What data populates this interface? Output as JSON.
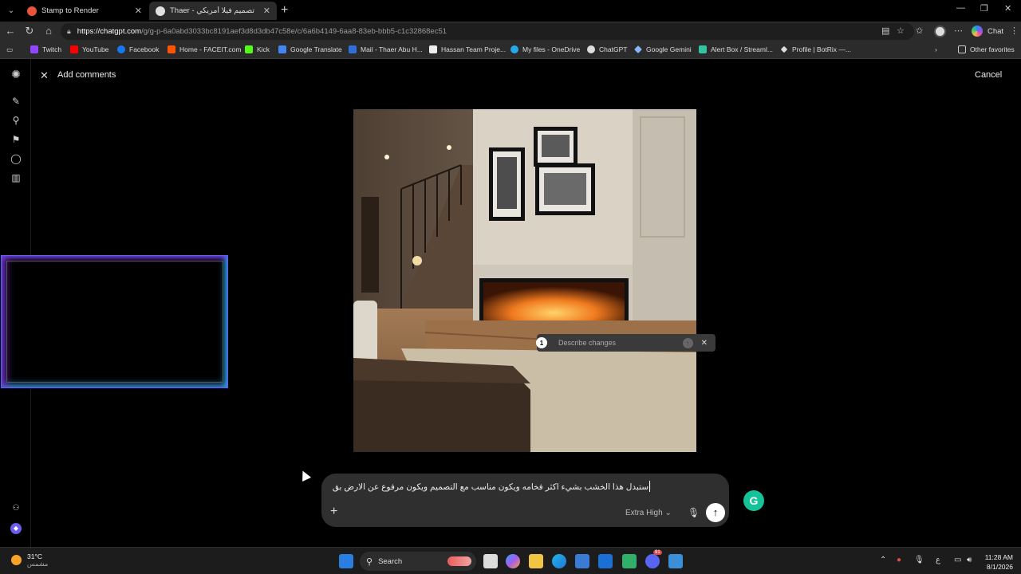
{
  "browser": {
    "tabs": [
      {
        "title": "Stamp to Render",
        "favicon_color": "#e8533a"
      },
      {
        "title": "Thaer - تصميم فيلا أمريكي",
        "favicon_color": "#e0e0e0"
      }
    ],
    "url": {
      "host": "https://chatgpt.com",
      "path": "/g/g-p-6a0abd3033bc8191aef3d8d3db47c58e/c/6a6b4149-6aa8-83eb-bbb5-c1c32868ec51"
    },
    "copilot_label": "Chat",
    "bookmarks": [
      {
        "label": "Twitch",
        "color": "#9146ff"
      },
      {
        "label": "YouTube",
        "color": "#ff0000"
      },
      {
        "label": "Facebook",
        "color": "#1877f2"
      },
      {
        "label": "Home - FACEIT.com",
        "color": "#ff5500"
      },
      {
        "label": "Kick",
        "color": "#53fc18"
      },
      {
        "label": "Google Translate",
        "color": "#4285f4"
      },
      {
        "label": "Mail - Thaer Abu H...",
        "color": "#2f6fdb"
      },
      {
        "label": "Hassan Team Proje...",
        "color": "#eeeeee"
      },
      {
        "label": "My files - OneDrive",
        "color": "#28a8ea"
      },
      {
        "label": "ChatGPT",
        "color": "#dddddd"
      },
      {
        "label": "Google Gemini",
        "color": "#8ab4f8"
      },
      {
        "label": "Alert Box / Streaml...",
        "color": "#31c3a2"
      },
      {
        "label": "Profile | BotRix —...",
        "color": "#dddddd"
      }
    ],
    "other_favorites": "Other favorites"
  },
  "editor": {
    "title": "Add comments",
    "cancel": "Cancel",
    "comment": {
      "number": "1",
      "placeholder": "Describe changes"
    }
  },
  "composer": {
    "text": "استبدل هذا الخشب بشيء اكثر فخامه ويكون مناسب مع التصميم ويكون مرفوع عن الارض بق",
    "model": "Extra High ⌄"
  },
  "taskbar": {
    "temp": "31°C",
    "condition": "مشمس",
    "search": "Search",
    "lang": "ع",
    "time": "11:28 AM",
    "date": "8/1/2026",
    "discord_badge": "91"
  }
}
